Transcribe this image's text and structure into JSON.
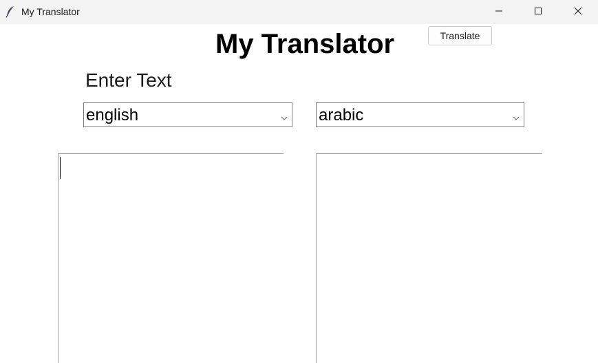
{
  "window": {
    "title": "My Translator",
    "icon": "feather-icon",
    "controls": [
      "minimize-icon",
      "maximize-icon",
      "close-icon"
    ]
  },
  "main": {
    "heading": "My Translator",
    "translate_button": "Translate",
    "enter_label": "Enter Text",
    "source_language": {
      "selected": "english"
    },
    "target_language": {
      "selected": "arabic"
    },
    "input_text": "",
    "output_text": ""
  }
}
